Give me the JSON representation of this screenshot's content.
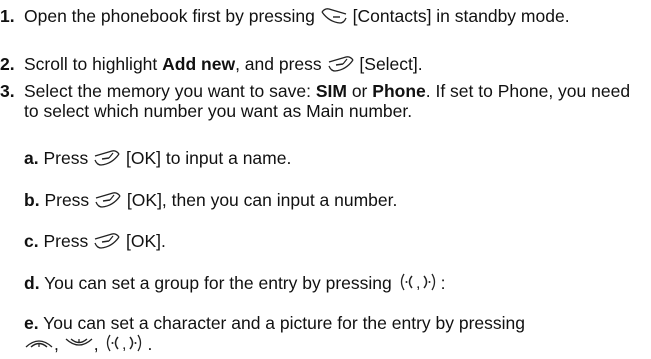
{
  "steps": [
    {
      "num": "1.",
      "a": "Open the phonebook first by pressing",
      "b": "[Contacts] in standby mode."
    },
    {
      "num": "2.",
      "a": "Scroll to highlight",
      "bold": "Add new",
      "b": ", and press",
      "c": "[Select]."
    },
    {
      "num": "3.",
      "a": "Select the memory you want to save:",
      "sim": "SIM",
      "or": "or",
      "phone": "Phone",
      "b": ". If set to Phone, you need to select which number you want as Main number."
    }
  ],
  "substeps": [
    {
      "letter": "a.",
      "pre": "Press",
      "post": "[OK] to input a name."
    },
    {
      "letter": "b.",
      "pre": "Press",
      "post": "[OK], then you can input a number."
    },
    {
      "letter": "c.",
      "pre": "Press",
      "post": "[OK]."
    },
    {
      "letter": "d.",
      "pre": "You can set a group for the entry by pressing",
      "post": ":"
    },
    {
      "letter": "e.",
      "pre": "You can set a character and a picture for the entry by pressing",
      "post": "."
    }
  ],
  "icons": {
    "right_soft_key": "right-soft-key-icon",
    "left_soft_key": "left-soft-key-icon",
    "nav_left_right": "nav-left-right-icon",
    "nav_up": "nav-up-icon",
    "nav_down": "nav-down-icon"
  },
  "colors": {
    "text": "#111111",
    "background": "#ffffff"
  }
}
